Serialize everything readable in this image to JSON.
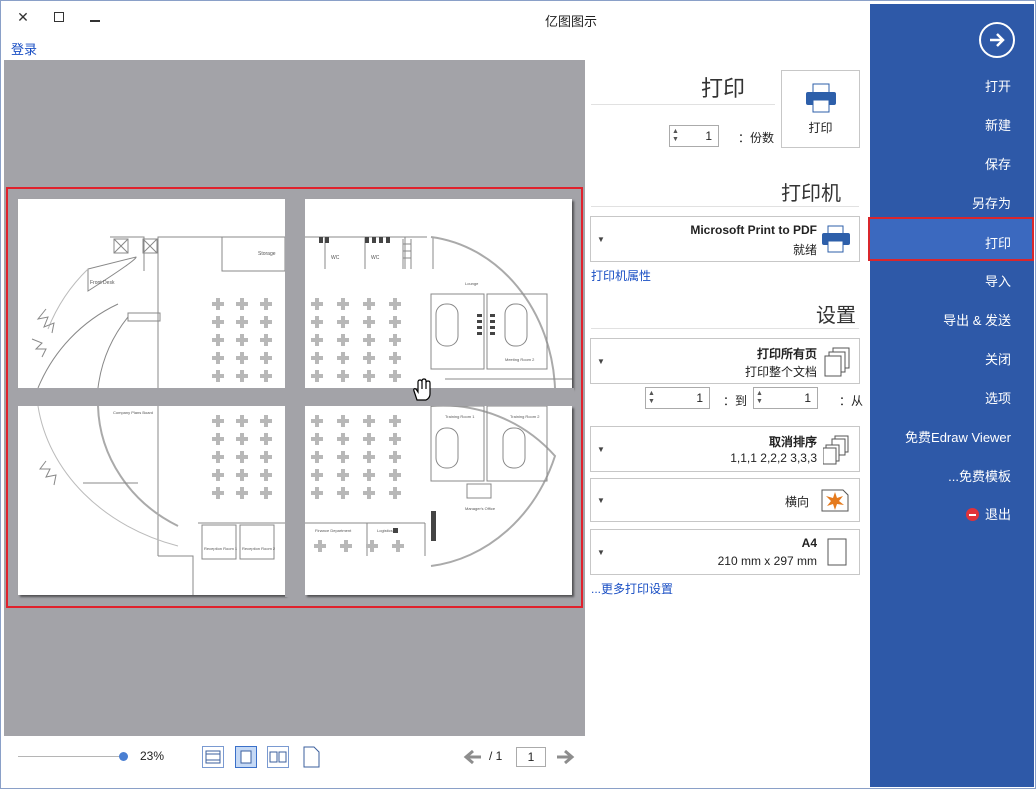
{
  "title": "亿图图示",
  "login_link": "登录",
  "sidebar": {
    "items": [
      {
        "label": "打开"
      },
      {
        "label": "新建"
      },
      {
        "label": "保存"
      },
      {
        "label": "另存为"
      },
      {
        "label": "打印"
      },
      {
        "label": "导入"
      },
      {
        "label": "导出 & 发送"
      },
      {
        "label": "关闭"
      },
      {
        "label": "选项"
      },
      {
        "label": "免费Edraw Viewer"
      },
      {
        "label": "免费模板..."
      },
      {
        "label": "退出"
      }
    ]
  },
  "print": {
    "header": "打印",
    "button_label": "打印",
    "copies_label": "份数：",
    "copies_value": "1"
  },
  "printer": {
    "header": "打印机",
    "name": "Microsoft Print to PDF",
    "status": "就绪",
    "properties_link": "打印机属性"
  },
  "settings": {
    "header": "设置",
    "scope_title": "打印所有页",
    "scope_sub": "打印整个文档",
    "from_label": "从：",
    "from_value": "1",
    "to_label": "到：",
    "to_value": "1",
    "collate_title": "取消排序",
    "collate_sub": "1,1,1  2,2,2  3,3,3",
    "orientation": "横向",
    "paper_title": "A4",
    "paper_sub": "210 mm x 297 mm",
    "more_link": "更多打印设置..."
  },
  "preview": {
    "zoom": "23%",
    "page_current": "1",
    "page_total": "/ 1",
    "labels": {
      "front_desk": "Front Desk",
      "storage": "Storage",
      "wc1": "WC",
      "wc2": "WC",
      "meeting2": "Meeting Room 2",
      "lounge": "Lounge",
      "training1": "Training Room 1",
      "training2": "Training Room 2",
      "managers_office": "Manager's Office",
      "finance": "Finance Department",
      "logistics": "Logistics",
      "company_plans": "Company Plans Board",
      "reception1": "Reception Room 1",
      "reception2": "Reception Room 2"
    }
  },
  "colors": {
    "sidebar": "#2e59a8",
    "highlight": "#d9262c",
    "accent": "#1a4fc4"
  }
}
